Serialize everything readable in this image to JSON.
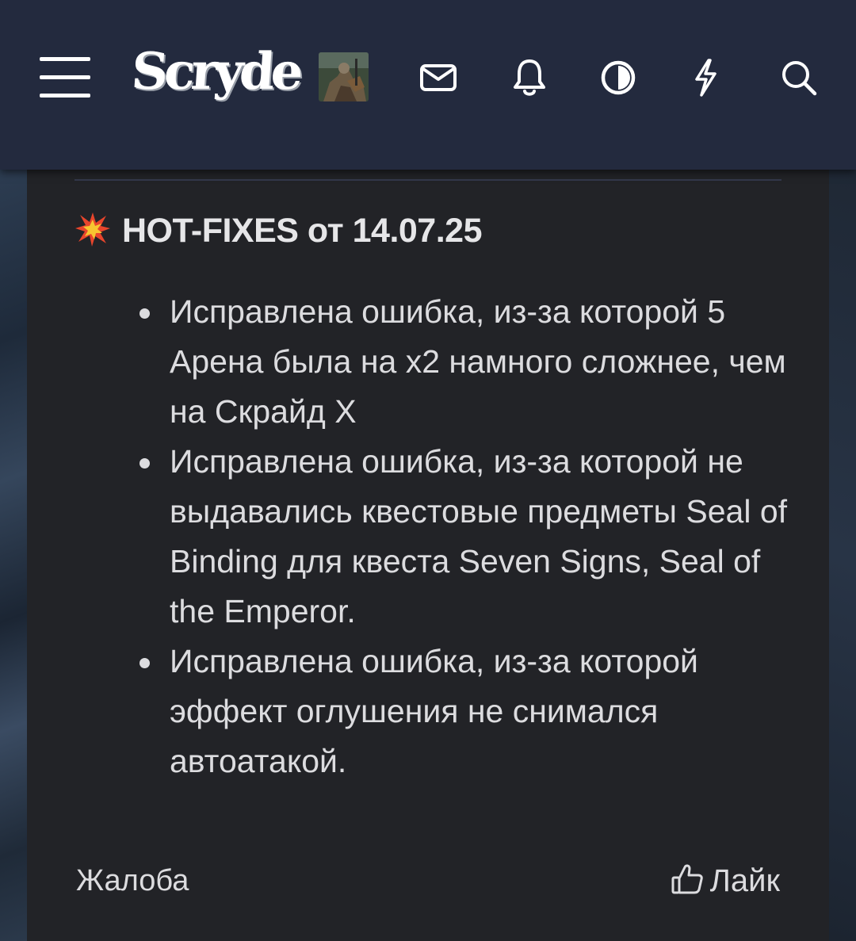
{
  "header": {
    "logo_text": "Scryde",
    "icons": [
      "menu-icon",
      "avatar",
      "mail-icon",
      "bell-icon",
      "contrast-icon",
      "lightning-icon",
      "search-icon"
    ]
  },
  "post": {
    "title_emoji": "collision-icon",
    "title": "HOT-FIXES от 14.07.25",
    "fixes": [
      "Исправлена ошибка, из-за которой 5 Арена была на х2 намного сложнее, чем на Скрайд X",
      "Исправлена ошибка, из-за которой не выдавались квестовые предметы Seal of Binding для квеста Seven Signs, Seal of the Emperor.",
      "Исправлена ошибка, из-за которой эффект оглушения не снимался автоатакой."
    ]
  },
  "footer": {
    "report_label": "Жалоба",
    "like_label": "Лайк"
  },
  "colors": {
    "header_bg": "#232a3e",
    "panel_bg": "#222327",
    "text": "#dcdcdf"
  }
}
